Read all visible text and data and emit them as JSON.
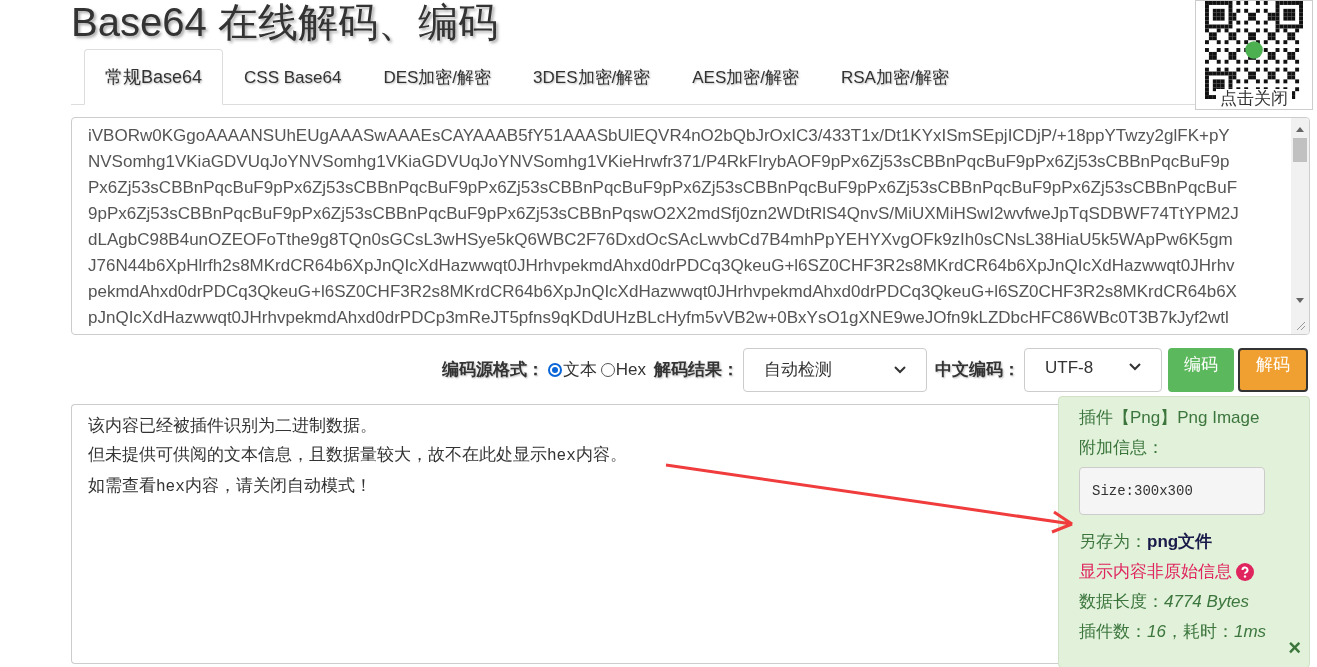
{
  "title": "Base64 在线解码、编码",
  "tabs": [
    {
      "label": "常规Base64",
      "selected": true
    },
    {
      "label": "CSS Base64",
      "selected": false
    },
    {
      "label": "DES加密/解密",
      "selected": false
    },
    {
      "label": "3DES加密/解密",
      "selected": false
    },
    {
      "label": "AES加密/解密",
      "selected": false
    },
    {
      "label": "RSA加密/解密",
      "selected": false
    }
  ],
  "qr": {
    "close_label": "点击关闭"
  },
  "input_lines": [
    "iVBORw0KGgoAAAANSUhEUgAAASwAAAEsCAYAAAB5fY51AAASbUlEQVR4nO2bQbJrOxIC3/433T1x/Dt1KYxISmSEpjICDjP/+18ppYTwzy2glFK+pY",
    "NVSomhg1VKiaGDVUqJoYNVSomhg1VKiaGDVUqJoYNVSomhg1VKieHrwfr371/P4RkFIrybAOF9pPx6Zj53sCBBnPqcBuF9pPx6Zj53sCBBnPqcBuF9p",
    "Px6Zj53sCBBnPqcBuF9pPx6Zj53sCBBnPqcBuF9pPx6Zj53sCBBnPqcBuF9pPx6Zj53sCBBnPqcBuF9pPx6Zj53sCBBnPqcBuF9pPx6Zj53sCBBnPqcBuF",
    "9pPx6Zj53sCBBnPqcBuF9pPx6Zj53sCBBnPqcBuF9pPx6Zj53sCBBnPqswO2X2mdSfj0zn2WDtRlS4QnvS/MiUXMiHSwI2wvfweJpTqSDBWF74TtYPM2J",
    "dLAgbC98B4unOZEOFoTthe9g8TQn0sGCsL3wHSye5kQ6WBC2F76DxdOcSAcLwvbCd7B4mhPpYEHYXvgOFk9zIh0sCNsL38HiaU5k5WApPw6K5gm",
    "J76N44b6XpHlrfh2s8MKrdCR64b6XpJnQIcXdHazwwqt0JHrhvpekmdAhxd0drPDCq3QkeuG+l6SZ0CHF3R2s8MKrdCR64b6XpJnQIcXdHazwwqt0JHrhv",
    "pekmdAhxd0drPDCq3QkeuG+l6SZ0CHF3R2s8MKrdCR64b6XpJnQIcXdHazwwqt0JHrhvpekmdAhxd0drPDCq3QkeuG+l6SZ0CHF3R2s8MKrdCR64b6X",
    "pJnQIcXdHazwwqt0JHrhvpekmdAhxd0drPDCp3mReJT5pfns9qKDdUHzBLcHyfm5vVB2w+0BxYsO1gXNE9weJOfn9kLZDbcHFC86WBc0T3B7kJyf2wtl"
  ],
  "controls": {
    "source_label": "编码源格式：",
    "source_options": [
      {
        "label": "文本",
        "selected": true
      },
      {
        "label": "Hex",
        "selected": false
      }
    ],
    "result_label": "解码结果：",
    "result_value": "自动检测",
    "charset_label": "中文编码：",
    "charset_value": "UTF-8",
    "encode_button": "编码",
    "decode_button": "解码"
  },
  "output_lines": [
    [
      {
        "text": "该内容已经被插件识别为二进制数据。",
        "mono": false
      }
    ],
    [
      {
        "text": "但未提供可供阅的文本信息，且数据量较大，故不在此处显示",
        "mono": false
      },
      {
        "text": "hex",
        "mono": true
      },
      {
        "text": "内容。",
        "mono": false
      }
    ],
    [
      {
        "text": "如需查看",
        "mono": false
      },
      {
        "text": "hex",
        "mono": true
      },
      {
        "text": "内容，请关闭自动模式！",
        "mono": false
      }
    ]
  ],
  "plugin_panel": {
    "plugin": "插件【Png】Png Image",
    "extra_label": "附加信息：",
    "extra_value": "Size:300x300",
    "save_label": "另存为：",
    "save_link": "png文件",
    "notice": "显示内容非原始信息",
    "length": "数据长度：*4774 Bytes*",
    "stats": "插件数：*16*，耗时：*1ms*",
    "close": "×"
  }
}
